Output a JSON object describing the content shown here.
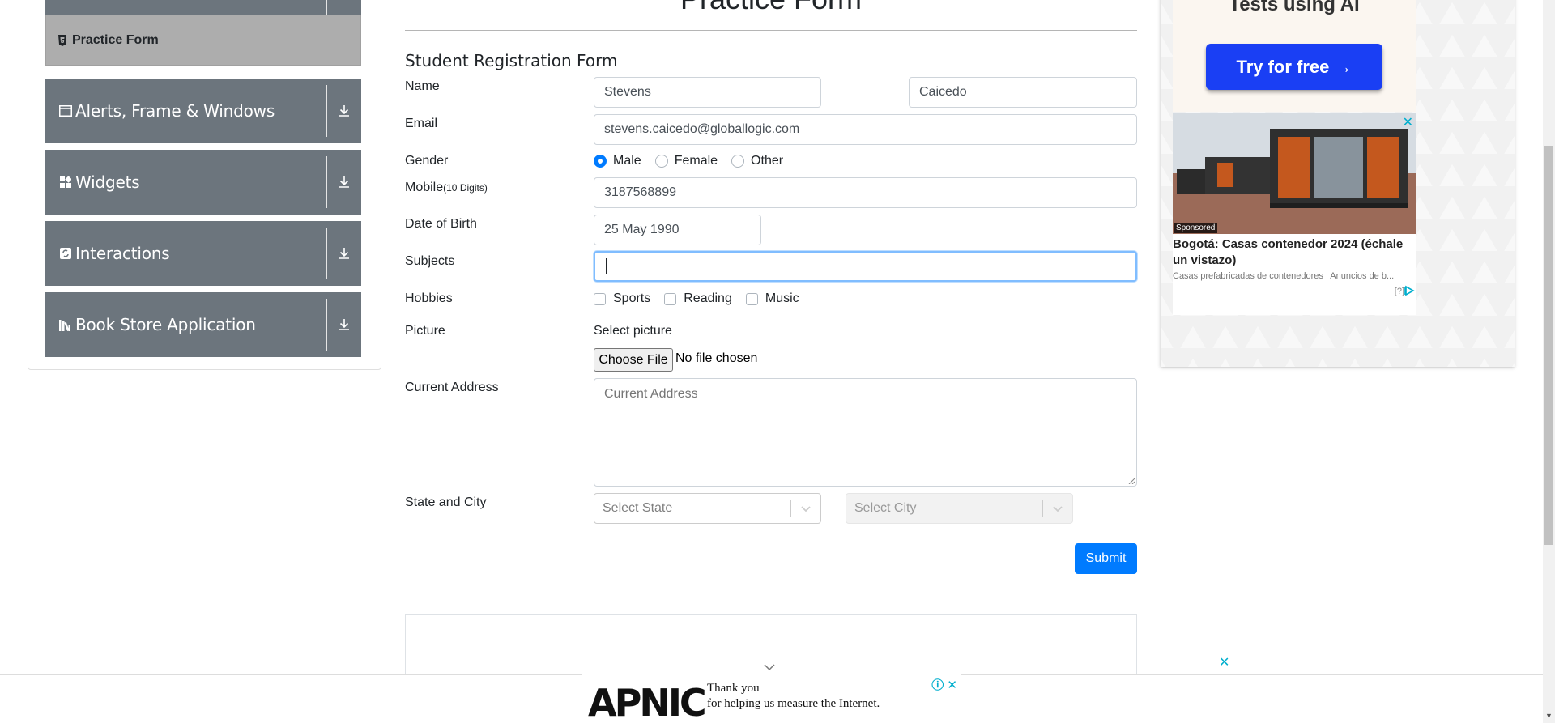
{
  "sidebar": {
    "active_item": "Practice Form",
    "groups": [
      {
        "label": "Alerts, Frame & Windows",
        "icon": "window-icon"
      },
      {
        "label": "Widgets",
        "icon": "widgets-icon"
      },
      {
        "label": "Interactions",
        "icon": "interactions-icon"
      },
      {
        "label": "Book Store Application",
        "icon": "books-icon"
      }
    ]
  },
  "page": {
    "title": "Practice Form",
    "form_heading": "Student Registration Form"
  },
  "form": {
    "name_label": "Name",
    "first_name": "Stevens",
    "last_name": "Caicedo",
    "email_label": "Email",
    "email": "stevens.caicedo@globallogic.com",
    "gender_label": "Gender",
    "gender_options": [
      "Male",
      "Female",
      "Other"
    ],
    "gender_selected": "Male",
    "mobile_label": "Mobile",
    "mobile_hint": "(10 Digits)",
    "mobile": "3187568899",
    "dob_label": "Date of Birth",
    "dob": "25 May 1990",
    "subjects_label": "Subjects",
    "subjects_value": "",
    "hobbies_label": "Hobbies",
    "hobbies": [
      "Sports",
      "Reading",
      "Music"
    ],
    "picture_label": "Picture",
    "select_picture": "Select picture",
    "choose_file": "Choose File",
    "no_file": "No file chosen",
    "address_label": "Current Address",
    "address_placeholder": "Current Address",
    "state_city_label": "State and City",
    "state_placeholder": "Select State",
    "city_placeholder": "Select City",
    "submit": "Submit"
  },
  "ad_right": {
    "top_text": "Tests using AI",
    "button": "Try for free →",
    "sponsored": "Sponsored",
    "headline": "Bogotá: Casas contenedor 2024 (échale un vistazo)",
    "source": "Casas prefabricadas de contenedores | Anuncios de b...",
    "tag": "[?]",
    "close": "✕"
  },
  "ad_bottom": {
    "logo": "APNIC",
    "line1": "Thank you",
    "line2": "for helping us measure the Internet.",
    "close": "✕"
  },
  "colors": {
    "sidebar_bg": "#6c757d",
    "active_bg": "#adadad",
    "primary": "#007bff",
    "ad_button": "#1a3ff4"
  }
}
